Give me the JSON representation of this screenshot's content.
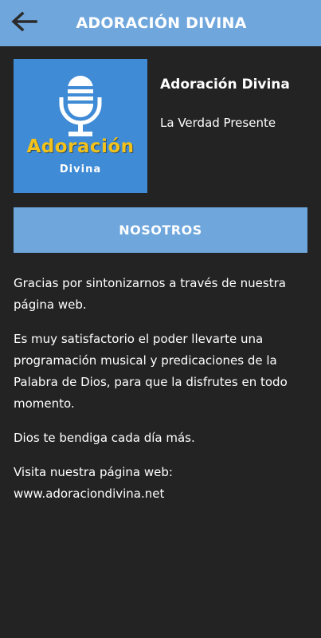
{
  "header": {
    "title": "ADORACIÓN DIVINA",
    "back_icon": "arrow-left-icon",
    "color": "#6fa6dc"
  },
  "logo": {
    "word": "Adoración",
    "sub": "Divina",
    "icon": "microphone-icon",
    "background": "#3f8bd6",
    "accent": "#f2c21a"
  },
  "station": {
    "name": "Adoración Divina",
    "slogan": "La Verdad Presente"
  },
  "section": {
    "label": "NOSOTROS"
  },
  "about": {
    "p1": "Gracias por sintonizarnos a través de nuestra página web.",
    "p2": "Es muy satisfactorio el poder llevarte una programación musical y predicaciones de la Palabra de Dios, para que la disfrutes en todo momento.",
    "p3": "Dios te bendiga cada día más.",
    "p4": "Visita nuestra página web: www.adoraciondivina.net"
  }
}
